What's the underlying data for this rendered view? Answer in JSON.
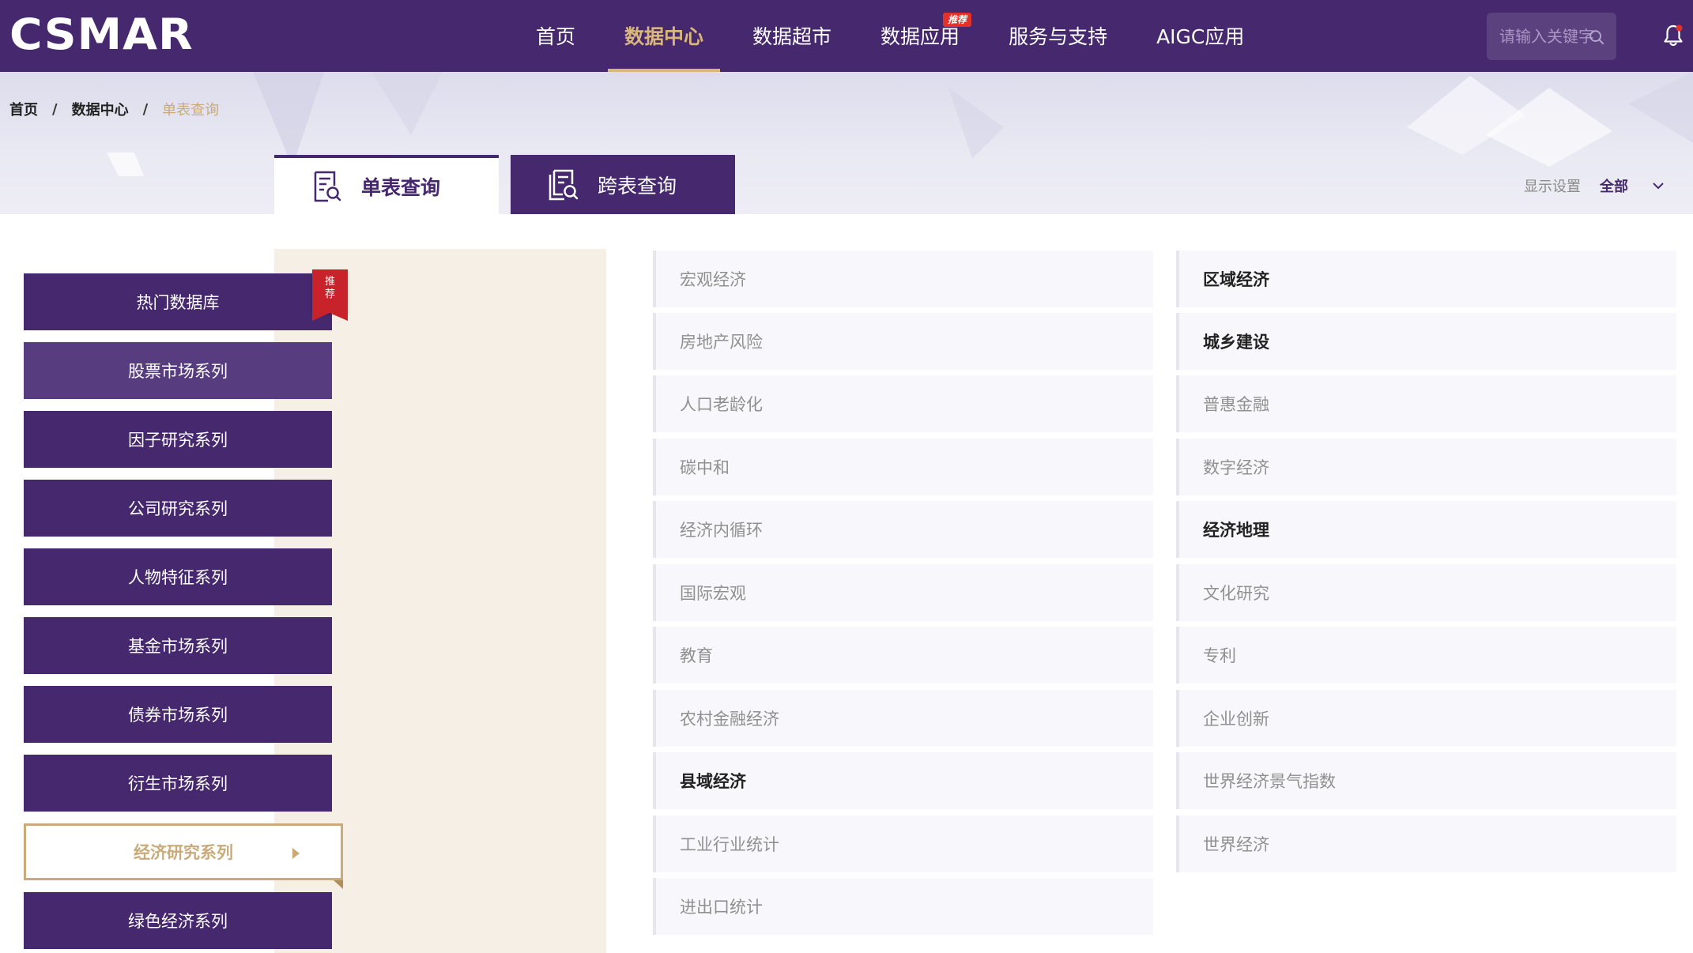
{
  "brand": {
    "logo_text": "CSMAR"
  },
  "nav": {
    "items": [
      {
        "label": "首页",
        "active": false
      },
      {
        "label": "数据中心",
        "active": true
      },
      {
        "label": "数据超市",
        "active": false
      },
      {
        "label": "数据应用",
        "active": false,
        "badge": "推荐"
      },
      {
        "label": "服务与支持",
        "active": false
      },
      {
        "label": "AIGC应用",
        "active": false
      }
    ]
  },
  "search": {
    "placeholder": "请输入关键字"
  },
  "breadcrumb": {
    "home": "首页",
    "sep": "/",
    "section": "数据中心",
    "current": "单表查询"
  },
  "tabs": [
    {
      "label": "单表查询",
      "active": true
    },
    {
      "label": "跨表查询",
      "active": false
    }
  ],
  "display_settings": {
    "label": "显示设置",
    "value": "全部"
  },
  "sidebar": {
    "ribbon": [
      "推",
      "荐"
    ],
    "items": [
      {
        "label": "热门数据库"
      },
      {
        "label": "股票市场系列"
      },
      {
        "label": "因子研究系列"
      },
      {
        "label": "公司研究系列"
      },
      {
        "label": "人物特征系列"
      },
      {
        "label": "基金市场系列"
      },
      {
        "label": "债券市场系列"
      },
      {
        "label": "衍生市场系列"
      },
      {
        "label": "经济研究系列",
        "active": true
      },
      {
        "label": "绿色经济系列"
      }
    ]
  },
  "categories": {
    "left": [
      {
        "label": "宏观经济",
        "bold": false
      },
      {
        "label": "房地产风险",
        "bold": false
      },
      {
        "label": "人口老龄化",
        "bold": false
      },
      {
        "label": "碳中和",
        "bold": false
      },
      {
        "label": "经济内循环",
        "bold": false
      },
      {
        "label": "国际宏观",
        "bold": false
      },
      {
        "label": "教育",
        "bold": false
      },
      {
        "label": "农村金融经济",
        "bold": false
      },
      {
        "label": "县域经济",
        "bold": true
      },
      {
        "label": "工业行业统计",
        "bold": false
      },
      {
        "label": "进出口统计",
        "bold": false
      }
    ],
    "right": [
      {
        "label": "区域经济",
        "bold": true
      },
      {
        "label": "城乡建设",
        "bold": true
      },
      {
        "label": "普惠金融",
        "bold": false
      },
      {
        "label": "数字经济",
        "bold": false
      },
      {
        "label": "经济地理",
        "bold": true
      },
      {
        "label": "文化研究",
        "bold": false
      },
      {
        "label": "专利",
        "bold": false
      },
      {
        "label": "企业创新",
        "bold": false
      },
      {
        "label": "世界经济景气指数",
        "bold": false
      },
      {
        "label": "世界经济",
        "bold": false
      }
    ]
  },
  "colors": {
    "primary": "#45286e",
    "gold": "#c9aa79",
    "badge_red": "#e0322b",
    "ribbon_red": "#c8232a"
  }
}
